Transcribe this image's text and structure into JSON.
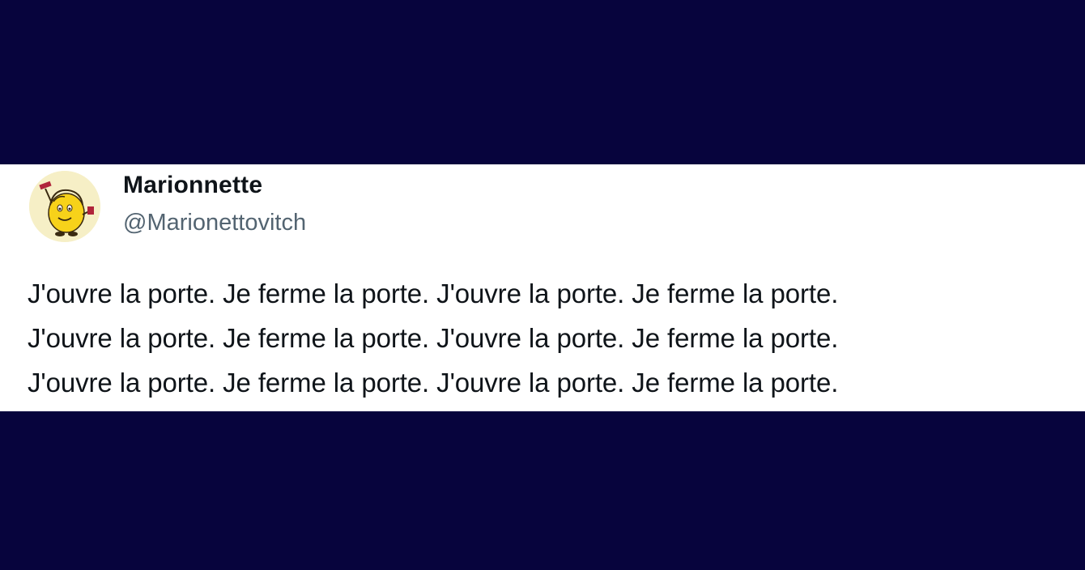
{
  "tweet": {
    "author": {
      "display_name": "Marionnette",
      "handle": "@Marionettovitch",
      "avatar_icon": "mr-men-character-avatar"
    },
    "lines": [
      "J'ouvre la porte. Je ferme la porte. J'ouvre la porte. Je ferme la porte.",
      "J'ouvre la porte. Je ferme la porte. J'ouvre la porte. Je ferme la porte.",
      "J'ouvre la porte. Je ferme la porte. J'ouvre la porte. Je ferme la porte."
    ]
  },
  "colors": {
    "background": "#07043d",
    "card": "#ffffff",
    "name_text": "#0f1419",
    "handle_text": "#536471"
  }
}
